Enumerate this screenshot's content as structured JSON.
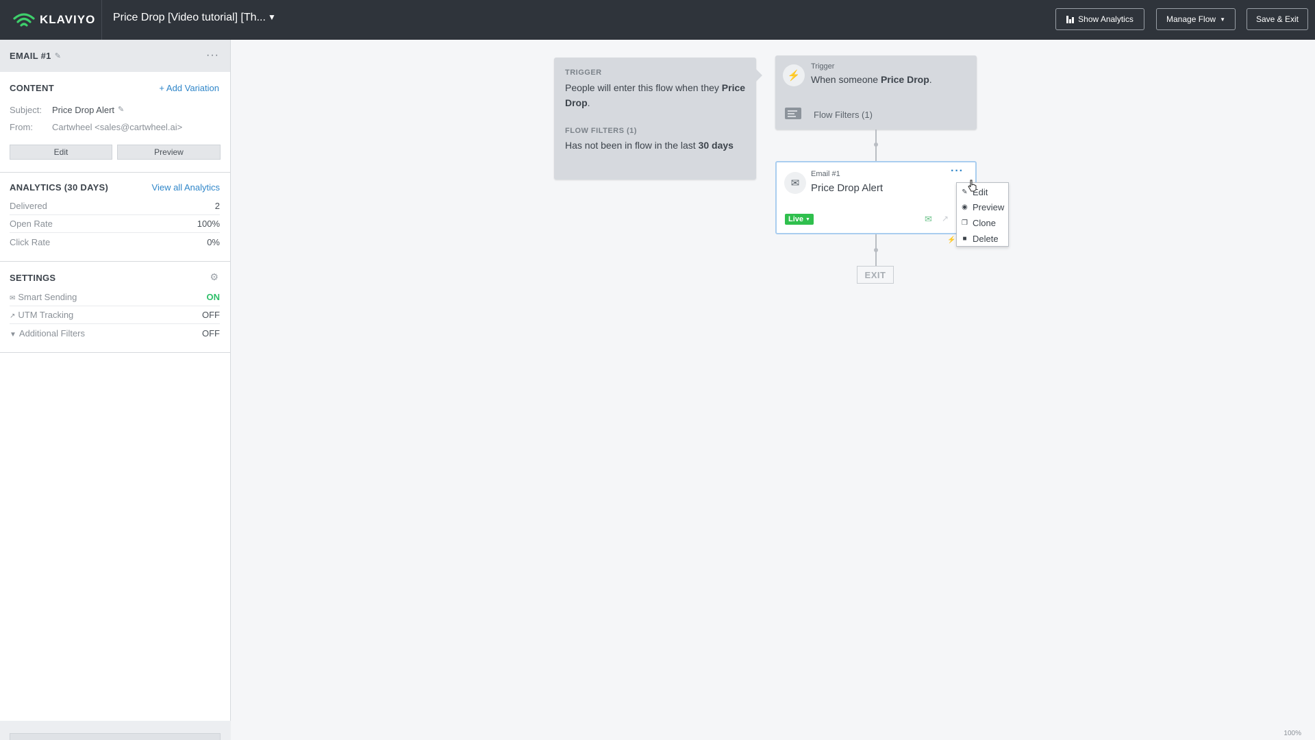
{
  "topbar": {
    "logo_text": "KLAVIYO",
    "flow_title": "Price Drop [Video tutorial] [Th...",
    "show_analytics": "Show Analytics",
    "manage_flow": "Manage Flow",
    "save_exit": "Save & Exit"
  },
  "sidebar": {
    "header_title": "EMAIL #1",
    "content": {
      "title": "CONTENT",
      "add_variation": "+ Add Variation",
      "subject_label": "Subject:",
      "subject_value": "Price Drop Alert",
      "from_label": "From:",
      "from_value": "Cartwheel <sales@cartwheel.ai>",
      "edit_button": "Edit",
      "preview_button": "Preview"
    },
    "analytics": {
      "title": "ANALYTICS (30 DAYS)",
      "view_all": "View all Analytics",
      "rows": [
        {
          "label": "Delivered",
          "value": "2"
        },
        {
          "label": "Open Rate",
          "value": "100%"
        },
        {
          "label": "Click Rate",
          "value": "0%"
        }
      ]
    },
    "settings": {
      "title": "SETTINGS",
      "rows": [
        {
          "label": "Smart Sending",
          "value": "ON"
        },
        {
          "label": "UTM Tracking",
          "value": "OFF"
        },
        {
          "label": "Additional Filters",
          "value": "OFF"
        }
      ]
    }
  },
  "canvas": {
    "trigger_info": {
      "trigger_label": "TRIGGER",
      "trigger_text_1": "People will enter this flow when they ",
      "trigger_text_bold": "Price Drop",
      "trigger_text_2": ".",
      "filters_label": "FLOW FILTERS (1)",
      "filters_text_1": "Has not been in flow in the last ",
      "filters_text_bold": "30 days"
    },
    "trigger_node": {
      "label": "Trigger",
      "text_1": "When someone ",
      "text_bold": "Price Drop",
      "text_2": ".",
      "flow_filters": "Flow Filters (1)"
    },
    "email_node": {
      "label": "Email #1",
      "title": "Price Drop Alert",
      "status": "Live"
    },
    "exit_label": "EXIT",
    "menu": {
      "items": [
        "Edit",
        "Preview",
        "Clone",
        "Delete"
      ]
    },
    "zoom": "100%"
  },
  "colors": {
    "topbar_bg": "#2f343b",
    "live_green": "#2fbf4d",
    "link_blue": "#2f86c9",
    "logo_green": "#3ecf6b"
  }
}
